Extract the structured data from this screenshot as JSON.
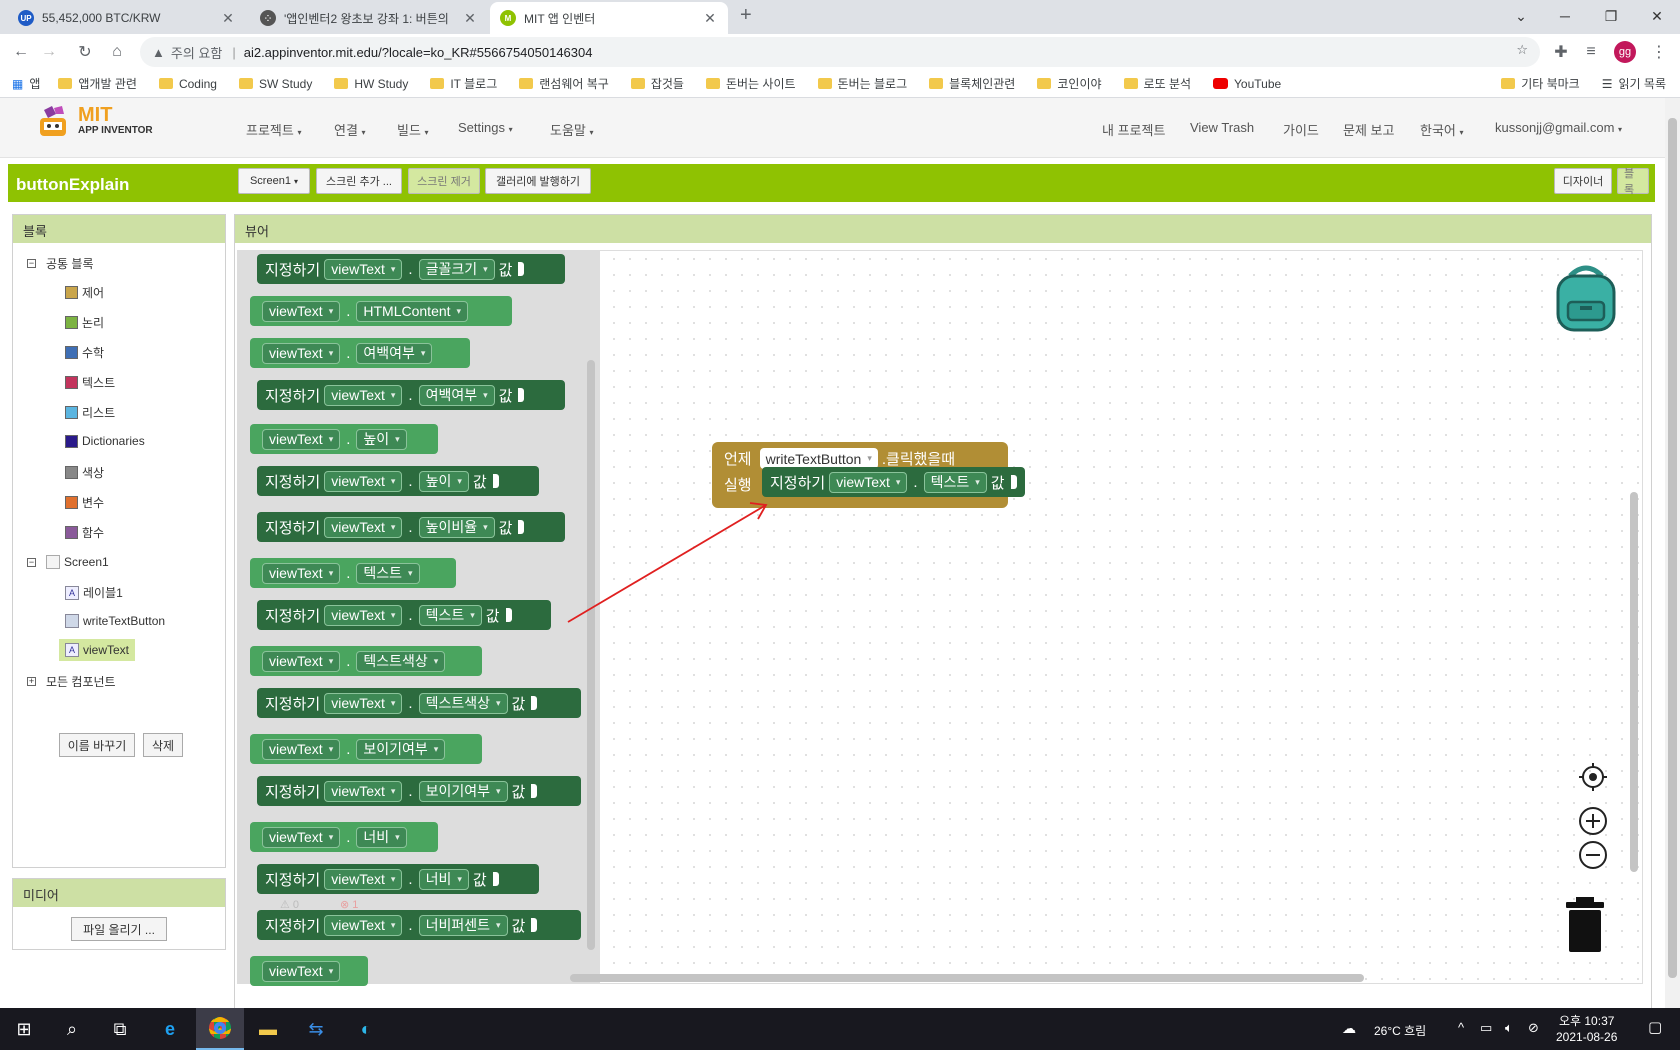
{
  "browser": {
    "tabs": [
      {
        "title": "55,452,000 BTC/KRW",
        "favicon": "up-icon",
        "color": "#1e5bc6"
      },
      {
        "title": "'앱인벤터2 왕초보 강좌 1: 버튼의",
        "favicon": "dots-icon",
        "color": "#444"
      },
      {
        "title": "MIT 앱 인벤터",
        "favicon": "mit-icon",
        "color": "#8fc202"
      }
    ],
    "new_tab": "+",
    "address": {
      "warning": "주의 요함",
      "url": "ai2.appinventor.mit.edu/?locale=ko_KR#5566754050146304"
    },
    "avatar": "gg",
    "bookmarks": [
      "앱",
      "앱개발 관련",
      "Coding",
      "SW Study",
      "HW Study",
      "IT 블로그",
      "랜섬웨어 복구",
      "잡것들",
      "돈버는 사이트",
      "돈버는 블로그",
      "블록체인관련",
      "코인이야",
      "로또 분석",
      "YouTube"
    ],
    "bookmarks_right": [
      "기타 북마크",
      "읽기 목록"
    ]
  },
  "app": {
    "logo": {
      "line1": "MIT",
      "line2": "APP INVENTOR"
    },
    "menu": [
      "프로젝트",
      "연결",
      "빌드",
      "Settings",
      "도움말"
    ],
    "right_menu": [
      "내 프로젝트",
      "View Trash",
      "가이드",
      "문제 보고",
      "한국어",
      "kussonjj@gmail.com"
    ],
    "project_name": "buttonExplain",
    "screen_select": "Screen1",
    "add_screen": "스크린 추가 ...",
    "remove_screen": "스크린 제거",
    "publish": "갤러리에 발행하기",
    "designer": "디자이너",
    "blocks": "블록"
  },
  "blocks_panel": {
    "title": "블록",
    "builtin_label": "공통 블록",
    "builtin": [
      {
        "label": "제어",
        "color": "#c9a54b"
      },
      {
        "label": "논리",
        "color": "#7cb342"
      },
      {
        "label": "수학",
        "color": "#3f6fb5"
      },
      {
        "label": "텍스트",
        "color": "#c3345d"
      },
      {
        "label": "리스트",
        "color": "#5bb5e0"
      },
      {
        "label": "Dictionaries",
        "color": "#2a1a8a"
      },
      {
        "label": "색상",
        "color": "#888888"
      },
      {
        "label": "변수",
        "color": "#e0702e"
      },
      {
        "label": "함수",
        "color": "#8a5a9a"
      }
    ],
    "screen": "Screen1",
    "components": [
      "레이블1",
      "writeTextButton",
      "viewText"
    ],
    "any_component": "모든 컴포넌트",
    "rename": "이름 바꾸기",
    "delete": "삭제"
  },
  "media": {
    "title": "미디어",
    "upload": "파일 올리기 ..."
  },
  "viewer": {
    "title": "뷰어",
    "flyout": [
      {
        "kind": "setter",
        "prefix": "지정하기",
        "comp": "viewText",
        "prop": "글꼴크기",
        "suffix": "값"
      },
      {
        "kind": "getter",
        "comp": "viewText",
        "prop": "HTMLContent"
      },
      {
        "kind": "getter",
        "comp": "viewText",
        "prop": "여백여부"
      },
      {
        "kind": "setter",
        "prefix": "지정하기",
        "comp": "viewText",
        "prop": "여백여부",
        "suffix": "값"
      },
      {
        "kind": "getter",
        "comp": "viewText",
        "prop": "높이"
      },
      {
        "kind": "setter",
        "prefix": "지정하기",
        "comp": "viewText",
        "prop": "높이",
        "suffix": "값"
      },
      {
        "kind": "setter",
        "prefix": "지정하기",
        "comp": "viewText",
        "prop": "높이비율",
        "suffix": "값"
      },
      {
        "kind": "getter",
        "comp": "viewText",
        "prop": "텍스트"
      },
      {
        "kind": "setter",
        "prefix": "지정하기",
        "comp": "viewText",
        "prop": "텍스트",
        "suffix": "값"
      },
      {
        "kind": "getter",
        "comp": "viewText",
        "prop": "텍스트색상"
      },
      {
        "kind": "setter",
        "prefix": "지정하기",
        "comp": "viewText",
        "prop": "텍스트색상",
        "suffix": "값"
      },
      {
        "kind": "getter",
        "comp": "viewText",
        "prop": "보이기여부"
      },
      {
        "kind": "setter",
        "prefix": "지정하기",
        "comp": "viewText",
        "prop": "보이기여부",
        "suffix": "값"
      },
      {
        "kind": "getter",
        "comp": "viewText",
        "prop": "너비"
      },
      {
        "kind": "setter",
        "prefix": "지정하기",
        "comp": "viewText",
        "prop": "너비",
        "suffix": "값"
      },
      {
        "kind": "setter",
        "prefix": "지정하기",
        "comp": "viewText",
        "prop": "너비퍼센트",
        "suffix": "값"
      },
      {
        "kind": "getter",
        "comp": "viewText",
        "prop": ""
      }
    ],
    "event_block": {
      "when": "언제",
      "comp": "writeTextButton",
      "event": ".클릭했을때",
      "do": "실행",
      "inner": {
        "prefix": "지정하기",
        "comp": "viewText",
        "prop": "텍스트",
        "suffix": "값"
      }
    },
    "warnings": {
      "warn_count": "0",
      "error_count": "1"
    }
  },
  "taskbar": {
    "weather": "26°C 흐림",
    "time": "오후 10:37",
    "date": "2021-08-26"
  }
}
